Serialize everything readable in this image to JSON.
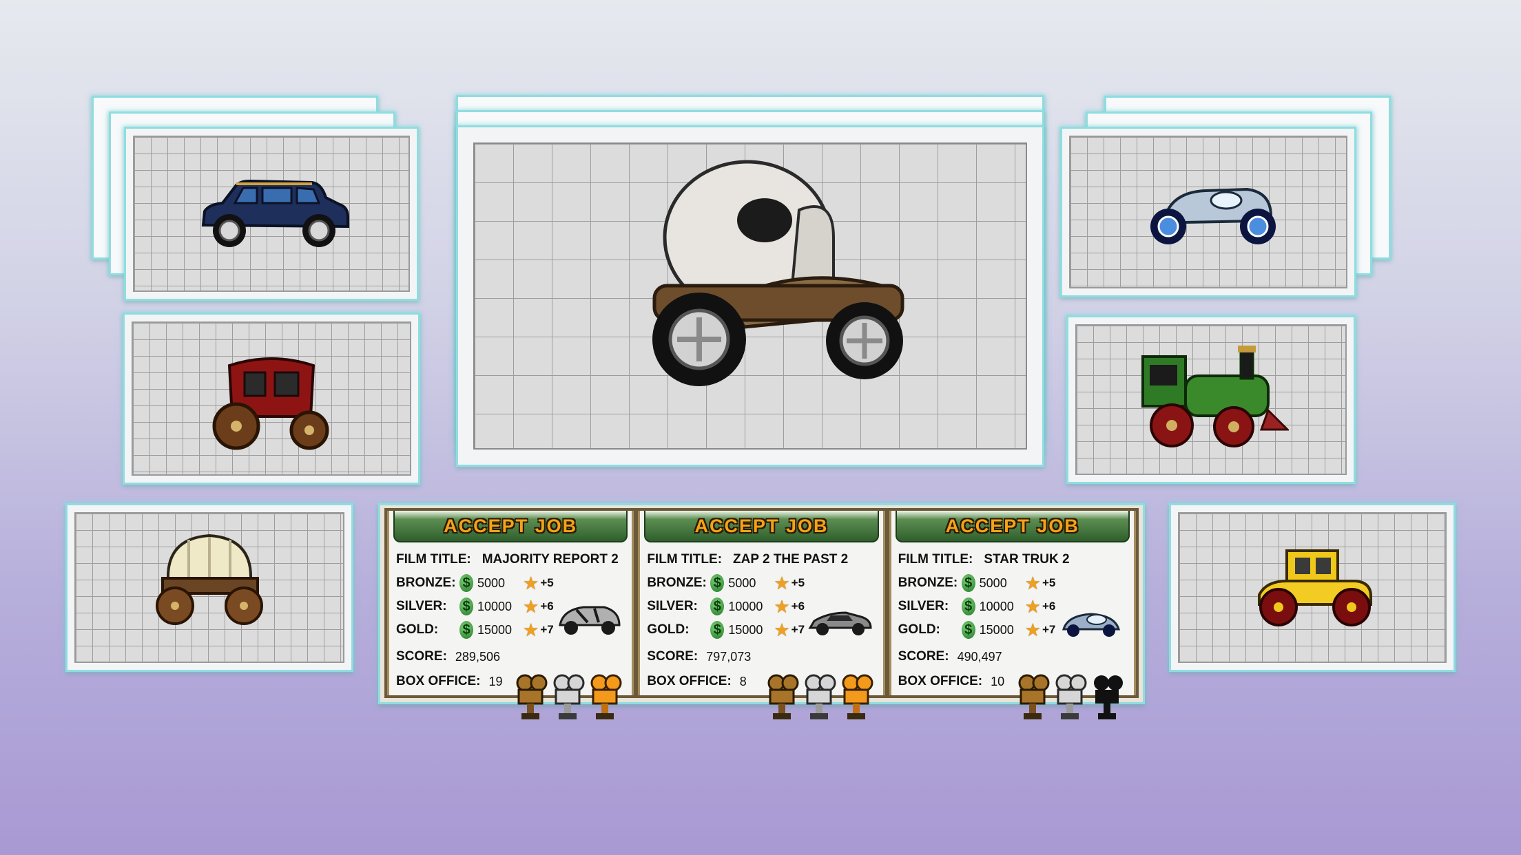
{
  "jobs": [
    {
      "accept_label": "ACCEPT JOB",
      "film_title_label": "FILM TITLE:",
      "film_title": "MAJORITY REPORT 2",
      "bronze": {
        "label": "BRONZE:",
        "amount": "5000",
        "bonus": "+5"
      },
      "silver": {
        "label": "SILVER:",
        "amount": "10000",
        "bonus": "+6"
      },
      "gold": {
        "label": "GOLD:",
        "amount": "15000",
        "bonus": "+7"
      },
      "score_label": "SCORE:",
      "score": "289,506",
      "box_office_label": "BOX OFFICE:",
      "box_office": "19",
      "trophies_earned": [
        "bronze",
        "silver",
        "gold"
      ],
      "car_icon": "futuristic-car-icon"
    },
    {
      "accept_label": "ACCEPT JOB",
      "film_title_label": "FILM TITLE:",
      "film_title": "ZAP 2 THE PAST 2",
      "bronze": {
        "label": "BRONZE:",
        "amount": "5000",
        "bonus": "+5"
      },
      "silver": {
        "label": "SILVER:",
        "amount": "10000",
        "bonus": "+6"
      },
      "gold": {
        "label": "GOLD:",
        "amount": "15000",
        "bonus": "+7"
      },
      "score_label": "SCORE:",
      "score": "797,073",
      "box_office_label": "BOX OFFICE:",
      "box_office": "8",
      "trophies_earned": [
        "bronze",
        "silver",
        "gold"
      ],
      "car_icon": "sports-car-icon"
    },
    {
      "accept_label": "ACCEPT JOB",
      "film_title_label": "FILM TITLE:",
      "film_title": "STAR TRUK 2",
      "bronze": {
        "label": "BRONZE:",
        "amount": "5000",
        "bonus": "+5"
      },
      "silver": {
        "label": "SILVER:",
        "amount": "10000",
        "bonus": "+6"
      },
      "gold": {
        "label": "GOLD:",
        "amount": "15000",
        "bonus": "+7"
      },
      "score_label": "SCORE:",
      "score": "490,497",
      "box_office_label": "BOX OFFICE:",
      "box_office": "10",
      "trophies_earned": [
        "bronze",
        "silver",
        "locked"
      ],
      "car_icon": "hover-car-icon"
    }
  ],
  "vehicles": {
    "top_left": "blue-suv-icon",
    "center": "skull-car-icon",
    "top_right": "silver-buggy-icon",
    "mid_left": "red-stagecoach-icon",
    "mid_right": "green-locomotive-icon",
    "bottom_left": "covered-wagon-icon",
    "bottom_right": "yellow-jalopy-icon"
  },
  "colors": {
    "panel_border": "#8fdde0",
    "accept_text": "#f5a21a",
    "accept_bg": "#2f5f2c",
    "trophy_bronze": "#a8742a",
    "trophy_silver": "#d6d6d6",
    "trophy_gold": "#f39a1c"
  }
}
